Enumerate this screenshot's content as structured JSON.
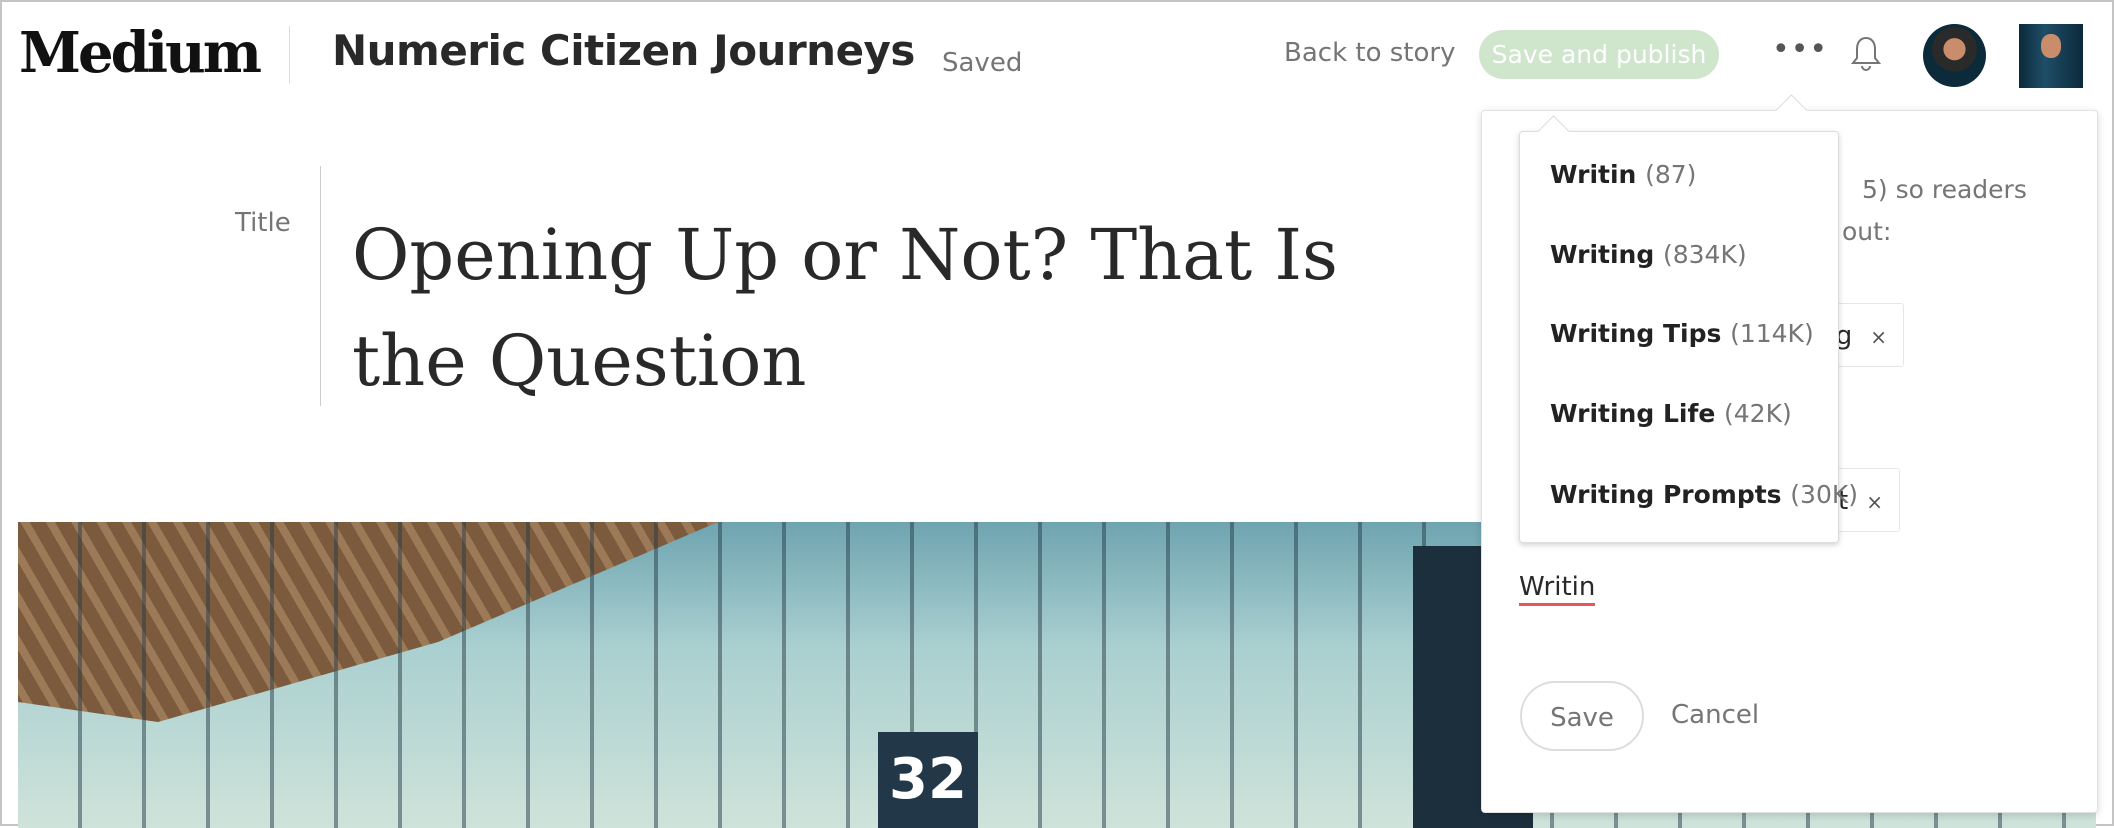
{
  "header": {
    "logo": "Medium",
    "publication": "Numeric Citizen Journeys",
    "status": "Saved",
    "back_link": "Back to story",
    "publish_button": "Save and publish",
    "more_icon": "more-horizontal-icon",
    "bell_icon": "bell-icon"
  },
  "editor": {
    "title_label": "Title",
    "headline": "Opening Up or Not? That Is the Question",
    "hero_sign": "32"
  },
  "topics_panel": {
    "intro_fragment_1": "5) so readers",
    "intro_fragment_2": "out:",
    "chips": [
      {
        "fragment": "g",
        "remove": "×"
      },
      {
        "fragment": "t",
        "remove": "×"
      }
    ],
    "input_value": "Writin",
    "save_label": "Save",
    "cancel_label": "Cancel",
    "suggestions": [
      {
        "name": "Writin",
        "count": "(87)"
      },
      {
        "name": "Writing",
        "count": "(834K)"
      },
      {
        "name": "Writing Tips",
        "count": "(114K)"
      },
      {
        "name": "Writing Life",
        "count": "(42K)"
      },
      {
        "name": "Writing Prompts",
        "count": "(30K)"
      }
    ]
  },
  "colors": {
    "publish_bg": "#cfe6cd",
    "input_underline": "#e8555a",
    "muted_text": "#757575"
  }
}
